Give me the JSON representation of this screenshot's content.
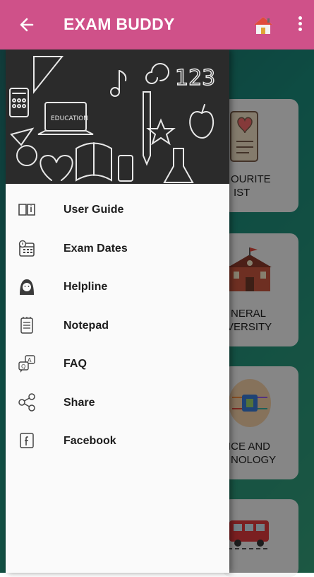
{
  "appbar": {
    "title": "EXAM BUDDY"
  },
  "background_cards": [
    {
      "label_line1": "OURITE",
      "label_line2": "IST"
    },
    {
      "label_line1": "NERAL",
      "label_line2": "VERSITY"
    },
    {
      "label_line1": "ICE AND",
      "label_line2": "NOLOGY"
    }
  ],
  "drawer": {
    "header_text": "EDUCATION",
    "items": [
      {
        "label": "User Guide",
        "icon": "book-icon"
      },
      {
        "label": "Exam Dates",
        "icon": "calendar-icon"
      },
      {
        "label": "Helpline",
        "icon": "support-agent-icon"
      },
      {
        "label": "Notepad",
        "icon": "notepad-icon"
      },
      {
        "label": "FAQ",
        "icon": "faq-icon"
      },
      {
        "label": "Share",
        "icon": "share-icon"
      },
      {
        "label": "Facebook",
        "icon": "facebook-icon"
      }
    ]
  },
  "colors": {
    "appbar": "#cf5189",
    "drawer": "#fafafa"
  }
}
